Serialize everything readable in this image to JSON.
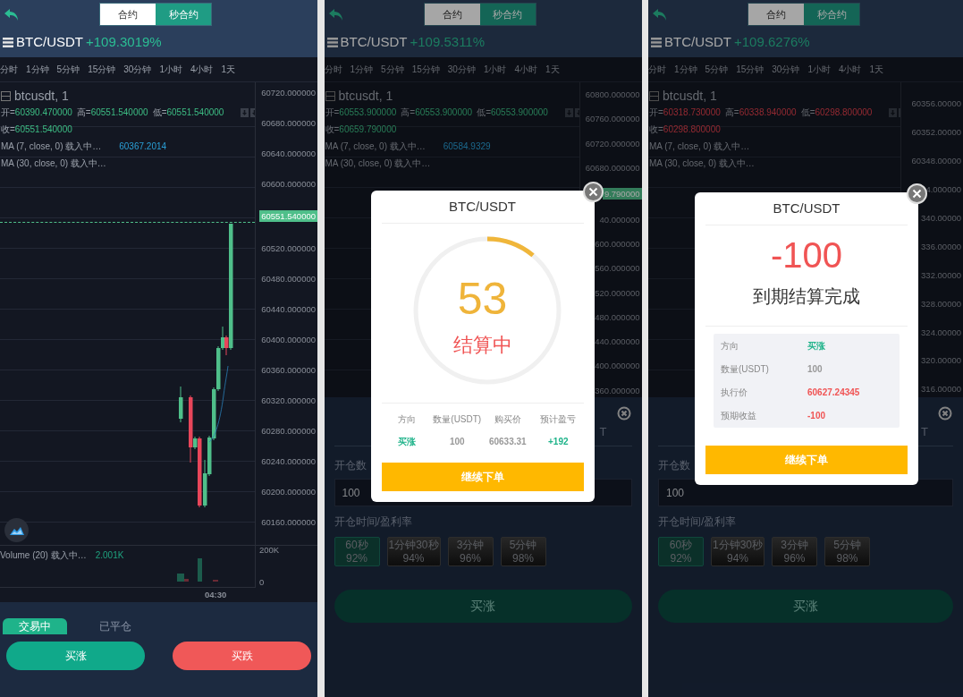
{
  "panels": [
    {
      "kind": "chart",
      "tabs": [
        {
          "label": "合约",
          "selected": false
        },
        {
          "label": "秒合约",
          "selected": true
        }
      ],
      "pair": "BTC/USDT",
      "change": "+109.3019%",
      "timeframes": [
        "分时",
        "1分钟",
        "5分钟",
        "15分钟",
        "30分钟",
        "1小时",
        "4小时",
        "1天"
      ],
      "legend": {
        "symbol": "btcusdt, 1",
        "falling": false,
        "ohlc": [
          {
            "label": "开=",
            "value": "60390.470000"
          },
          {
            "label": "高=",
            "value": "60551.540000"
          },
          {
            "label": "低=",
            "value": "60551.540000"
          }
        ],
        "close": {
          "label": "收=",
          "value": "60551.540000"
        },
        "ma": [
          {
            "label": "MA (7, close, 0) 载入中…",
            "value": "60367.2014"
          },
          {
            "label": "MA (30, close, 0) 载入中…"
          }
        ]
      },
      "price_axis": [
        {
          "kind": "tick",
          "label": "60720.000000"
        },
        {
          "kind": "tick",
          "label": "60680.000000"
        },
        {
          "kind": "tick",
          "label": "60640.000000"
        },
        {
          "kind": "tick",
          "label": "60600.000000"
        },
        {
          "kind": "tag",
          "label": "60551.540000"
        },
        {
          "kind": "tick",
          "label": "60520.000000"
        },
        {
          "kind": "tick",
          "label": "60480.000000"
        },
        {
          "kind": "tick",
          "label": "60440.000000"
        },
        {
          "kind": "tick",
          "label": "60400.000000"
        },
        {
          "kind": "tick",
          "label": "60360.000000"
        },
        {
          "kind": "tick",
          "label": "60320.000000"
        },
        {
          "kind": "tick",
          "label": "60280.000000"
        },
        {
          "kind": "tick",
          "label": "60240.000000"
        },
        {
          "kind": "tick",
          "label": "60200.000000"
        },
        {
          "kind": "tick",
          "label": "60160.000000"
        }
      ],
      "volume": {
        "label": "Volume (20) 载入中…",
        "value": "2.001K",
        "axis": [
          "200K",
          "0"
        ],
        "time": "04:30"
      },
      "bottom": {
        "kind": "positions",
        "tabs": [
          {
            "label": "交易中",
            "selected": true
          },
          {
            "label": "已平仓",
            "selected": false
          }
        ],
        "buttons": [
          {
            "label": "买涨",
            "kind": "buy"
          },
          {
            "label": "买跌",
            "kind": "sell"
          }
        ]
      }
    },
    {
      "kind": "countdown",
      "tabs": [
        {
          "label": "合约",
          "selected": false
        },
        {
          "label": "秒合约",
          "selected": true
        }
      ],
      "pair": "BTC/USDT",
      "change": "+109.5311%",
      "timeframes": [
        "分时",
        "1分钟",
        "5分钟",
        "15分钟",
        "30分钟",
        "1小时",
        "4小时",
        "1天"
      ],
      "legend": {
        "symbol": "btcusdt, 1",
        "falling": false,
        "ohlc": [
          {
            "label": "开=",
            "value": "60553.900000"
          },
          {
            "label": "高=",
            "value": "60553.900000"
          },
          {
            "label": "低=",
            "value": "60553.900000"
          }
        ],
        "close": {
          "label": "收=",
          "value": "60659.790000"
        },
        "ma": [
          {
            "label": "MA (7, close, 0) 载入中…",
            "value": "60584.9329"
          },
          {
            "label": "MA (30, close, 0) 载入中…"
          }
        ]
      },
      "price_axis": [
        {
          "kind": "tick",
          "label": "60800.000000"
        },
        {
          "kind": "tick",
          "label": "60760.000000"
        },
        {
          "kind": "tick",
          "label": "60720.000000"
        },
        {
          "kind": "tick",
          "label": "60680.000000"
        },
        {
          "kind": "tag",
          "label": "9.790000"
        },
        {
          "kind": "tick",
          "label": "40.000000"
        },
        {
          "kind": "tick",
          "label": "600.000000"
        },
        {
          "kind": "tick",
          "label": "560.000000"
        },
        {
          "kind": "tick",
          "label": "520.000000"
        },
        {
          "kind": "tick",
          "label": "480.000000"
        },
        {
          "kind": "tick",
          "label": "440.000000"
        },
        {
          "kind": "tick",
          "label": "400.000000"
        },
        {
          "kind": "tick",
          "label": "360.000000"
        }
      ],
      "bottom": {
        "kind": "order_form",
        "unit_fragment": "T",
        "amount_label": "开仓数",
        "amount": "100",
        "duration_label": "开仓时间/盈利率",
        "options": [
          {
            "time": "60秒",
            "rate": "92%",
            "selected": true
          },
          {
            "time": "1分钟30秒",
            "rate": "94%",
            "selected": false
          },
          {
            "time": "3分钟",
            "rate": "96%",
            "selected": false
          },
          {
            "time": "5分钟",
            "rate": "98%",
            "selected": false
          }
        ],
        "submit": "买涨"
      },
      "modal": {
        "kind": "countdown",
        "title": "BTC/USDT",
        "seconds": "53",
        "level": 0.11,
        "status": "结算中",
        "columns": [
          "方向",
          "数量(USDT)",
          "购买价",
          "预计盈亏"
        ],
        "row": [
          {
            "value": "买涨",
            "color": "#1fb38a"
          },
          {
            "value": "100",
            "color": "#999999"
          },
          {
            "value": "60633.31",
            "color": "#999999"
          },
          {
            "value": "+192",
            "color": "#1fb38a"
          }
        ],
        "button": "继续下单"
      }
    },
    {
      "kind": "result",
      "tabs": [
        {
          "label": "合约",
          "selected": false
        },
        {
          "label": "秒合约",
          "selected": true
        }
      ],
      "pair": "BTC/USDT",
      "change": "+109.6276%",
      "timeframes": [
        "分时",
        "1分钟",
        "5分钟",
        "15分钟",
        "30分钟",
        "1小时",
        "4小时",
        "1天"
      ],
      "legend": {
        "symbol": "btcusdt, 1",
        "falling": true,
        "ohlc": [
          {
            "label": "开=",
            "value": "60318.730000"
          },
          {
            "label": "高=",
            "value": "60338.940000"
          },
          {
            "label": "低=",
            "value": "60298.800000"
          }
        ],
        "close": {
          "label": "收=",
          "value": "60298.800000"
        },
        "ma": [
          {
            "label": "MA (7, close, 0) 载入中…"
          },
          {
            "label": "MA (30, close, 0) 载入中…"
          }
        ]
      },
      "price_axis": [
        {
          "kind": "tick",
          "label": "60356.00000"
        },
        {
          "kind": "tick",
          "label": "60352.00000"
        },
        {
          "kind": "tick",
          "label": "60348.00000"
        },
        {
          "kind": "tick",
          "label": "4.000000"
        },
        {
          "kind": "tick",
          "label": "340.00000"
        },
        {
          "kind": "tick",
          "label": "336.00000"
        },
        {
          "kind": "tick",
          "label": "332.00000"
        },
        {
          "kind": "tick",
          "label": "328.00000"
        },
        {
          "kind": "tick",
          "label": "324.00000"
        },
        {
          "kind": "tick",
          "label": "320.00000"
        },
        {
          "kind": "tick",
          "label": "316.00000"
        }
      ],
      "bottom": {
        "kind": "order_form",
        "unit_fragment": "T",
        "amount_label": "开仓数",
        "amount": "100",
        "duration_label": "开仓时间/盈利率",
        "options": [
          {
            "time": "60秒",
            "rate": "92%",
            "selected": true
          },
          {
            "time": "1分钟30秒",
            "rate": "94%",
            "selected": false
          },
          {
            "time": "3分钟",
            "rate": "96%",
            "selected": false
          },
          {
            "time": "5分钟",
            "rate": "98%",
            "selected": false
          }
        ],
        "submit": "买涨"
      },
      "modal": {
        "kind": "result",
        "title": "BTC/USDT",
        "amount": "-100",
        "negative": true,
        "status": "到期结算完成",
        "details": [
          {
            "label": "方向",
            "value": "买涨",
            "color": "#1fb38a"
          },
          {
            "label": "数量(USDT)",
            "value": "100",
            "color": "#999999"
          },
          {
            "label": "执行价",
            "value": "60627.24345",
            "color": "#f05454"
          },
          {
            "label": "预期收益",
            "value": "-100",
            "color": "#f05454"
          }
        ],
        "button": "继续下单"
      }
    }
  ]
}
